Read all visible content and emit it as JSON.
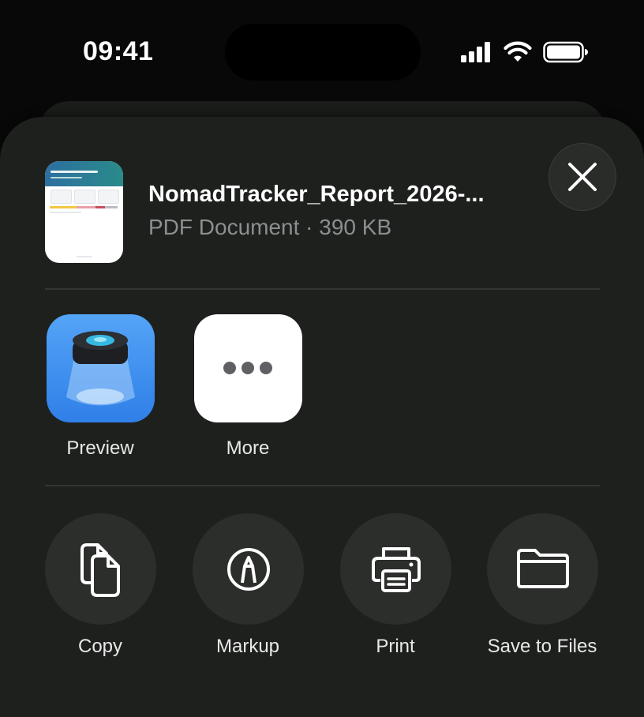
{
  "status_bar": {
    "time": "09:41",
    "icons": [
      "cellular-signal-icon",
      "wifi-icon",
      "battery-icon"
    ]
  },
  "file": {
    "name": "NomadTracker_Report_2026-...",
    "meta": "PDF Document · 390 KB",
    "thumbnail_icon": "pdf-thumbnail",
    "thumbnail_title": "Days & Residency Report"
  },
  "close": {
    "icon": "close-icon"
  },
  "apps": [
    {
      "label": "Preview",
      "icon": "preview-app-icon"
    },
    {
      "label": "More",
      "icon": "more-icon"
    }
  ],
  "actions": [
    {
      "label": "Copy",
      "icon": "copy-icon"
    },
    {
      "label": "Markup",
      "icon": "markup-icon"
    },
    {
      "label": "Print",
      "icon": "print-icon"
    },
    {
      "label": "Save to Files",
      "icon": "folder-icon"
    }
  ],
  "colors": {
    "background": "#070807",
    "sheet": "#1e201e",
    "action_circle": "#2c2e2c",
    "secondary_text": "#8e8e91",
    "preview_blue": "#3a8ef0"
  }
}
